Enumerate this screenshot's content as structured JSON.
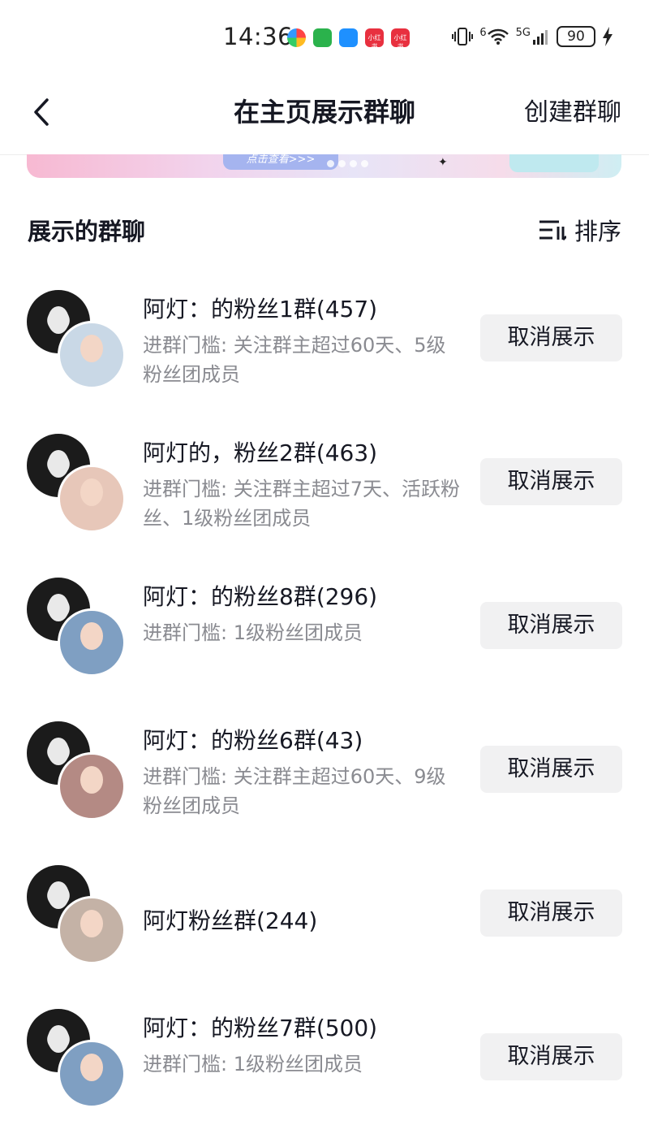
{
  "status_bar": {
    "time": "14:36",
    "app_icons": [
      "colorful-app-icon",
      "wechat-icon",
      "message-icon",
      "xiaohongshu-icon",
      "xiaohongshu-icon"
    ],
    "xhs_label": "小红书",
    "network": "5G",
    "signal_superscript": "6",
    "battery": "90"
  },
  "nav": {
    "title": "在主页展示群聊",
    "create_label": "创建群聊"
  },
  "banner": {
    "button_label": "点击查看>>>"
  },
  "section": {
    "title": "展示的群聊",
    "sort_label": "排序"
  },
  "groups": [
    {
      "name": "阿灯：的粉丝1群(457)",
      "requirement": "进群门槛: 关注群主超过60天、5级粉丝团成员",
      "button": "取消展示",
      "member_color": "#c9d8e6"
    },
    {
      "name": "阿灯的，粉丝2群(463)",
      "requirement": "进群门槛: 关注群主超过7天、活跃粉丝、1级粉丝团成员",
      "button": "取消展示",
      "member_color": "#e7c7b9"
    },
    {
      "name": "阿灯：的粉丝8群(296)",
      "requirement": "进群门槛: 1级粉丝团成员",
      "button": "取消展示",
      "member_color": "#7f9fc2"
    },
    {
      "name": "阿灯：的粉丝6群(43)",
      "requirement": "进群门槛: 关注群主超过60天、9级粉丝团成员",
      "button": "取消展示",
      "member_color": "#b48a84"
    },
    {
      "name": "阿灯粉丝群(244)",
      "requirement": "",
      "button": "取消展示",
      "member_color": "#c4b2a6"
    },
    {
      "name": "阿灯：的粉丝7群(500)",
      "requirement": "进群门槛: 1级粉丝团成员",
      "button": "取消展示",
      "member_color": "#7f9fc2"
    }
  ]
}
